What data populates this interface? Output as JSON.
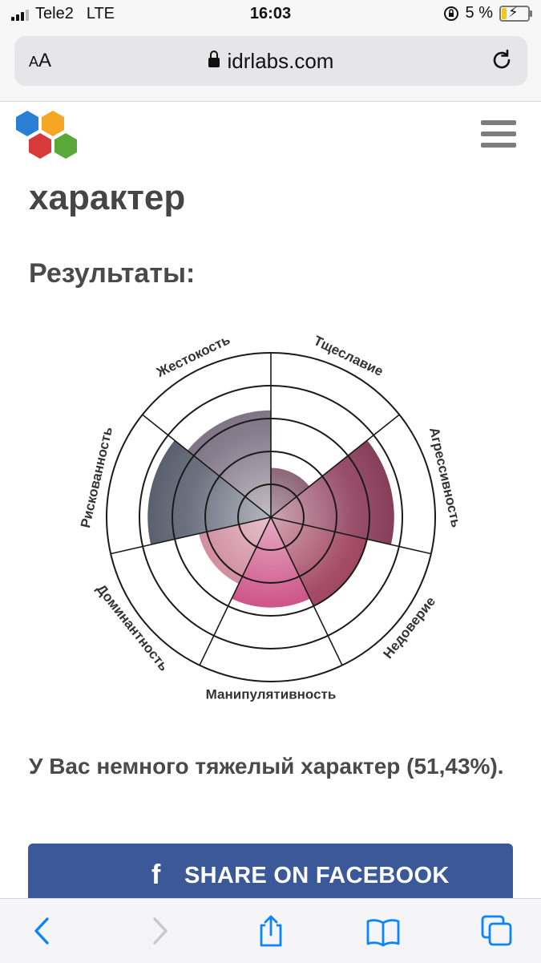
{
  "status_bar": {
    "carrier": "Tele2",
    "network": "LTE",
    "time": "16:03",
    "battery_percent": "5 %",
    "battery_level": 0.05
  },
  "browser": {
    "text_size_label_small": "A",
    "text_size_label_large": "A",
    "url": "idrlabs.com"
  },
  "page": {
    "title": "характер",
    "results_heading": "Результаты:",
    "result_text": "У Вас немного тяжелый характер (51,43%).",
    "share_button": "SHARE ON FACEBOOK",
    "share_icon": "f"
  },
  "colors": {
    "facebook": "#3b5998",
    "logo_blue": "#2a7fd4",
    "logo_orange": "#f5a623",
    "logo_red": "#d83a3a",
    "logo_green": "#5ba83a",
    "ios_blue": "#0a84ff"
  },
  "chart_data": {
    "type": "polar-area",
    "categories": [
      "Тщеславие",
      "Агрессивность",
      "Недоверие",
      "Манипулятивность",
      "Доминантность",
      "Рискованность",
      "Жестокость"
    ],
    "values": [
      30,
      75,
      60,
      55,
      45,
      75,
      65
    ],
    "value_range": [
      0,
      100
    ],
    "ring_count": 5,
    "colors": [
      "#5e2640",
      "#8c3a57",
      "#9a3755",
      "#c8457d",
      "#c8768e",
      "#5a6070",
      "#7a6e80"
    ]
  },
  "toolbar": {
    "icons": [
      "back-icon",
      "forward-icon",
      "share-icon",
      "bookmarks-icon",
      "tabs-icon"
    ]
  }
}
